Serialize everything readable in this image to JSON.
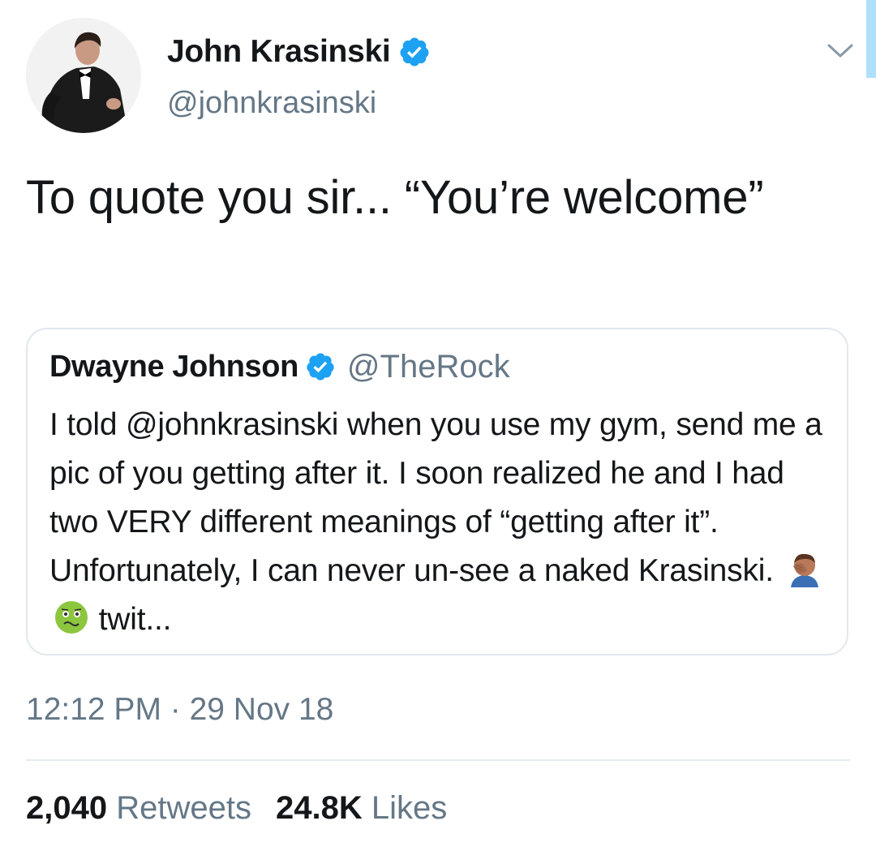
{
  "tweet": {
    "author": {
      "name": "John Krasinski",
      "handle": "@johnkrasinski",
      "verified": true
    },
    "text": "To quote you sir... “You’re welcome”",
    "quoted": {
      "name": "Dwayne Johnson",
      "handle": "@TheRock",
      "verified": true,
      "text": "I told @johnkrasinski when you use my gym, send me a pic of you getting after it. I soon realized he and I had two VERY different meanings of “getting after it”. Unfortunately, I can never un-see a naked Krasinski.",
      "emojis": [
        "face-palm-emoji",
        "nauseated-face-emoji"
      ],
      "link_text": "twit..."
    },
    "timestamp": "12:12 PM · 29 Nov 18",
    "stats": {
      "retweets_count": "2,040",
      "retweets_label": "Retweets",
      "likes_count": "24.8K",
      "likes_label": "Likes"
    }
  },
  "icons": {
    "verified": "verified-badge-icon",
    "menu": "chevron-down-icon"
  },
  "colors": {
    "verified_blue": "#1da1f2",
    "secondary_text": "#657786",
    "border": "#e1e8ed"
  }
}
